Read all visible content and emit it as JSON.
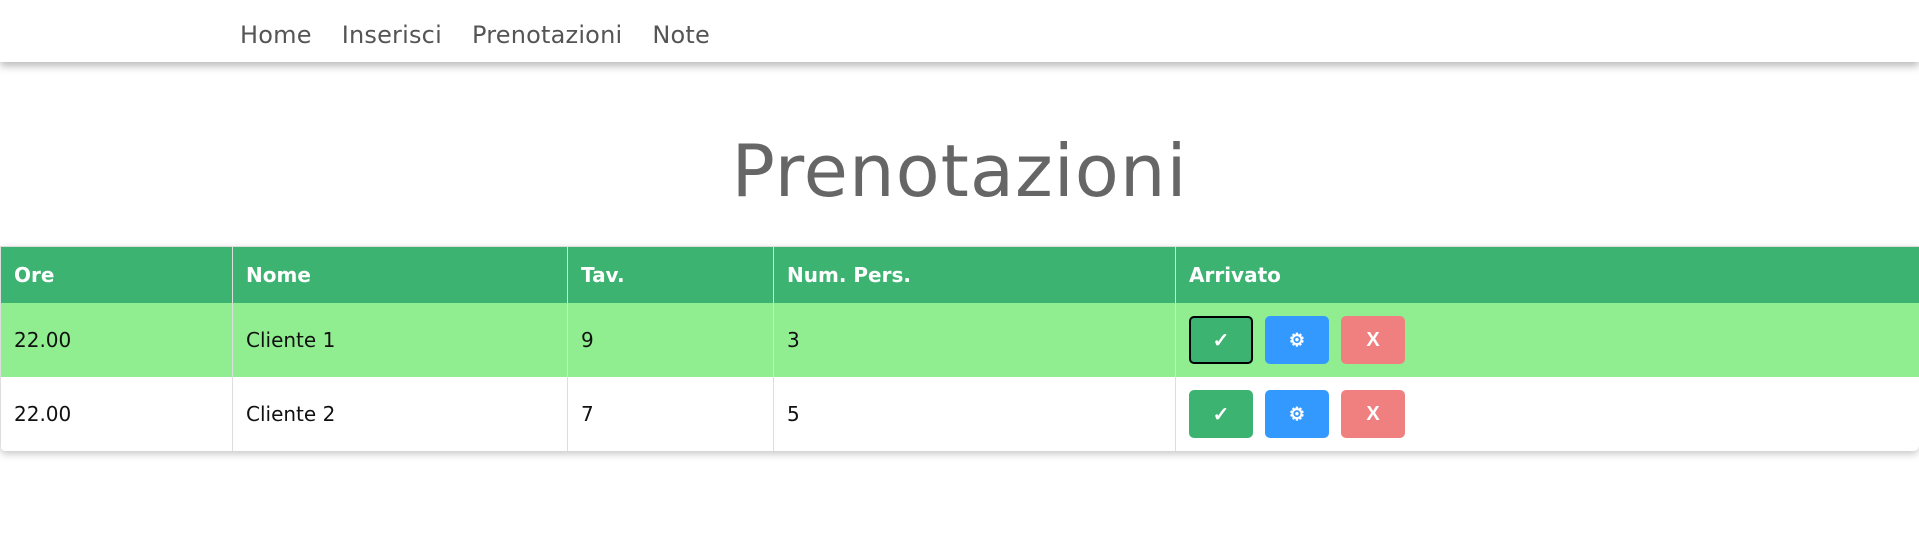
{
  "nav": {
    "links": [
      "Home",
      "Inserisci",
      "Prenotazioni",
      "Note"
    ]
  },
  "page": {
    "title": "Prenotazioni"
  },
  "table": {
    "headers": [
      "Ore",
      "Nome",
      "Tav.",
      "Num. Pers.",
      "Arrivato"
    ],
    "rows": [
      {
        "ore": "22.00",
        "nome": "Cliente 1",
        "tav": "9",
        "pers": "3",
        "highlighted": true
      },
      {
        "ore": "22.00",
        "nome": "Cliente 2",
        "tav": "7",
        "pers": "5",
        "highlighted": false
      }
    ],
    "actions": {
      "confirm_label": "✓",
      "edit_label": "⚙",
      "delete_label": "X"
    }
  },
  "colors": {
    "header_green": "#3cb371",
    "highlight_row": "#90ee90",
    "edit_blue": "#3399ff",
    "delete_red": "#f08080"
  },
  "icons": {
    "confirm": "check-icon",
    "edit": "gear-icon",
    "delete": "close-icon"
  }
}
